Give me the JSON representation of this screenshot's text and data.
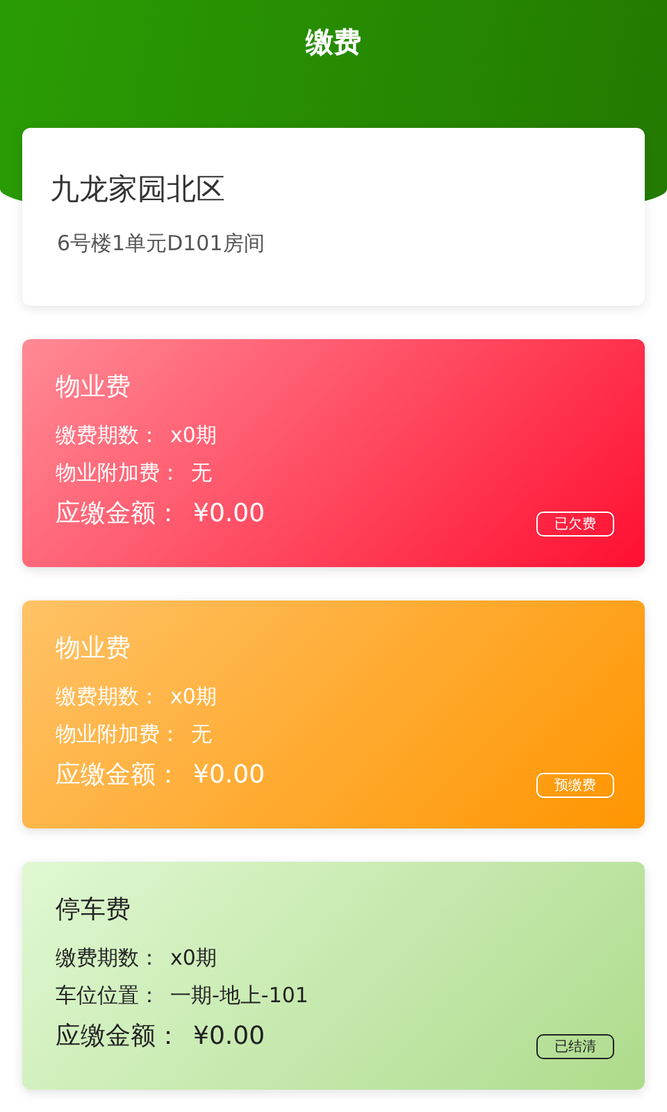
{
  "header": {
    "title": "缴费"
  },
  "address": {
    "community": "九龙家园北区",
    "room": "6号楼1单元D101房间"
  },
  "fees": [
    {
      "kind": "arrears",
      "title": "物业费",
      "lines": [
        {
          "label": "缴费期数：",
          "value": "x0期"
        },
        {
          "label": "物业附加费：",
          "value": "无"
        },
        {
          "label": "应缴金额：",
          "value": "¥0.00",
          "amount": true
        }
      ],
      "status": "已欠费"
    },
    {
      "kind": "prepaid",
      "title": "物业费",
      "lines": [
        {
          "label": "缴费期数：",
          "value": "x0期"
        },
        {
          "label": "物业附加费：",
          "value": "无"
        },
        {
          "label": "应缴金额：",
          "value": "¥0.00",
          "amount": true
        }
      ],
      "status": "预缴费"
    },
    {
      "kind": "settled",
      "title": "停车费",
      "lines": [
        {
          "label": "缴费期数：",
          "value": "x0期"
        },
        {
          "label": "车位位置：",
          "value": "一期-地上-101"
        },
        {
          "label": "应缴金额：",
          "value": "¥0.00",
          "amount": true
        }
      ],
      "status": "已结清"
    }
  ]
}
